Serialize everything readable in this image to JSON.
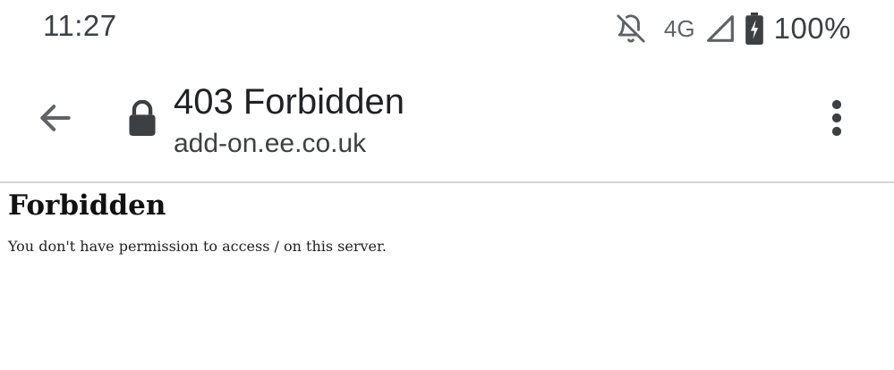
{
  "status_bar": {
    "time": "11:27",
    "network_type": "4G",
    "battery_percent": "100%",
    "icons": [
      "notifications-off-icon",
      "signal-icon",
      "battery-charging-icon"
    ]
  },
  "toolbar": {
    "title": "403 Forbidden",
    "url": "add-on.ee.co.uk",
    "icons": [
      "back-arrow-icon",
      "lock-icon",
      "more-vert-icon"
    ]
  },
  "page": {
    "heading": "Forbidden",
    "message": "You don't have permission to access / on this server."
  }
}
